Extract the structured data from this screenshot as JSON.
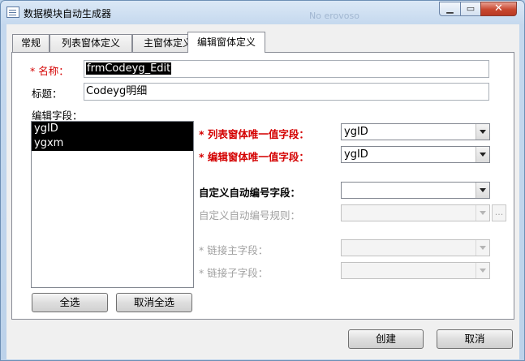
{
  "window": {
    "title": "数据模块自动生成器",
    "ghost_text": "No erovoso",
    "minimize_glyph": "▁",
    "maximize_glyph": "▭",
    "close_glyph": "✕"
  },
  "tabs": [
    {
      "label": "常规"
    },
    {
      "label": "列表窗体定义"
    },
    {
      "label": "主窗体定义"
    },
    {
      "label": "编辑窗体定义"
    }
  ],
  "edit_form": {
    "name_label": "* 名称：",
    "name_value": "frmCodeyg_Edit",
    "title_label": "标题：",
    "title_value": "Codeyg明细",
    "fields_label": "编辑字段：",
    "fields": [
      "ygID",
      "ygxm"
    ],
    "list_unique_label": "* 列表窗体唯一值字段：",
    "list_unique_value": "ygID",
    "edit_unique_label": "* 编辑窗体唯一值字段：",
    "edit_unique_value": "ygID",
    "auto_number_label": "自定义自动编号字段：",
    "auto_number_value": "",
    "auto_rule_label": "自定义自动编号规则：",
    "auto_rule_value": "",
    "ellipsis_label": "...",
    "link_master_label": "* 链接主字段：",
    "link_master_value": "",
    "link_child_label": "* 链接子字段：",
    "link_child_value": "",
    "select_all_label": "全选",
    "deselect_all_label": "取消全选"
  },
  "footer": {
    "create_label": "创建",
    "cancel_label": "取消"
  },
  "colors": {
    "required_label": "#d40000",
    "disabled_label": "#a0a0a0",
    "selection": "#000000"
  }
}
